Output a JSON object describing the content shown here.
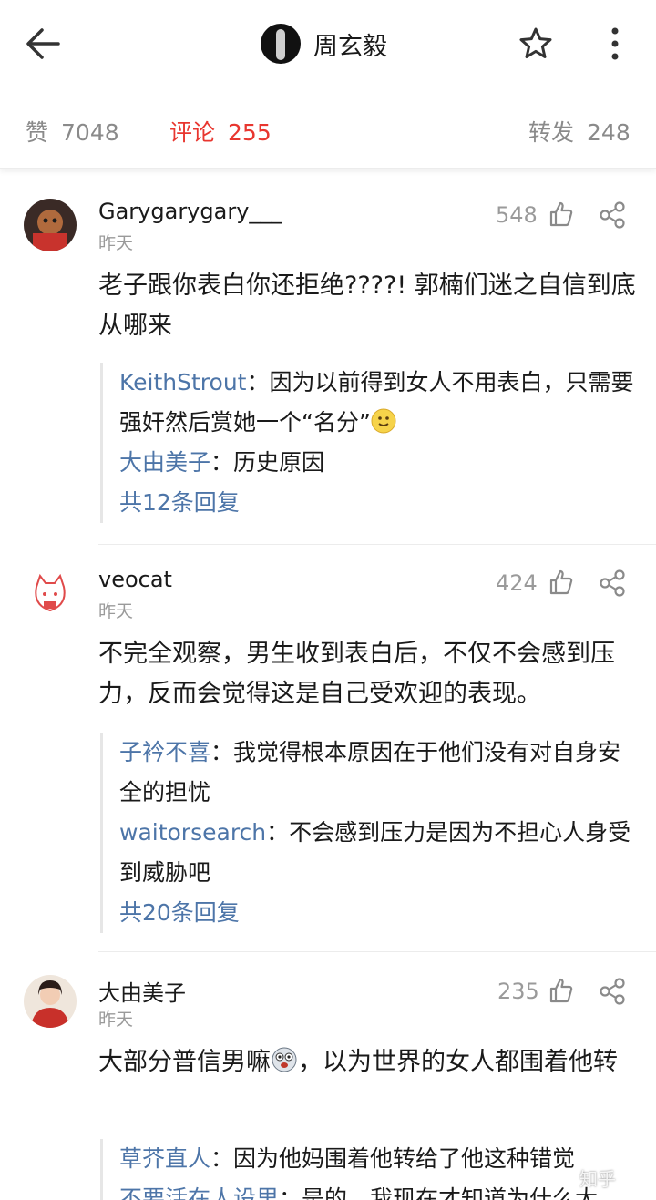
{
  "header": {
    "title": "周玄毅",
    "back_icon": "arrow-left-icon",
    "star_icon": "star-outline-icon",
    "more_icon": "more-vertical-icon"
  },
  "stats": {
    "like_label": "赞",
    "like_count": "7048",
    "comment_label": "评论",
    "comment_count": "255",
    "repost_label": "转发",
    "repost_count": "248",
    "accent_color": "#e8362f"
  },
  "comments": [
    {
      "name": "Garygarygary___",
      "time": "昨天",
      "likes": "548",
      "text": "老子跟你表白你还拒绝????! 郭楠们迷之自信到底从哪来",
      "replies": [
        {
          "name": "KeithStrout",
          "sep": "：",
          "text": "因为以前得到女人不用表白，只需要强奸然后赏她一个“名分”",
          "emoji": "slightly-smiling-face-icon"
        },
        {
          "name": "大由美子",
          "sep": "：",
          "text": "历史原因"
        }
      ],
      "more": "共12条回复"
    },
    {
      "name": "veocat",
      "time": "昨天",
      "likes": "424",
      "text": "不完全观察，男生收到表白后，不仅不会感到压力，反而会觉得这是自己受欢迎的表现。",
      "replies": [
        {
          "name": "子衿不喜",
          "sep": "：",
          "text": "我觉得根本原因在于他们没有对自身安全的担忧"
        },
        {
          "name": "waitorsearch",
          "sep": "：",
          "text": "不会感到压力是因为不担心人身受到威胁吧"
        }
      ],
      "more": "共20条回复"
    },
    {
      "name": "大由美子",
      "time": "昨天",
      "likes": "235",
      "text_a": "大部分普信男嘛",
      "text_b": "，以为世界的女人都围着他转",
      "emoji": "dog-face-emoji",
      "replies": [
        {
          "name": "草芥直人",
          "sep": "：",
          "text": "因为他妈围着他转给了他这种错觉"
        },
        {
          "name": "不要活在人设里",
          "sep": "：",
          "text": "是的，我现在才知道为什么大"
        }
      ]
    }
  ],
  "watermark": "知乎"
}
